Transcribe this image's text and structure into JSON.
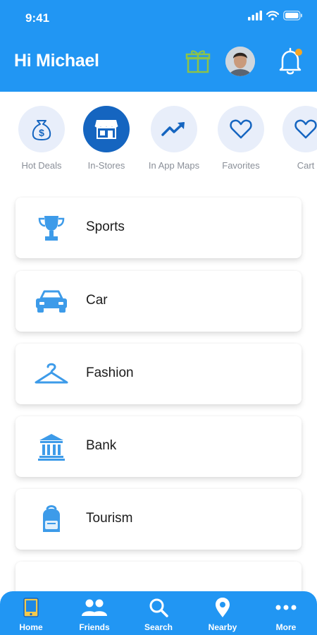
{
  "status": {
    "time": "9:41"
  },
  "header": {
    "greeting": "Hi Michael",
    "bell_badge_color": "#f5a623"
  },
  "colors": {
    "primary": "#2196f3",
    "active": "#1565c0",
    "icon": "#3d9be9",
    "gift": "#8bc34a"
  },
  "quick_actions": [
    {
      "label": "Hot Deals",
      "icon": "money-bag-icon",
      "active": false
    },
    {
      "label": "In-Stores",
      "icon": "store-icon",
      "active": true
    },
    {
      "label": "In App Maps",
      "icon": "trending-up-icon",
      "active": false
    },
    {
      "label": "Favorites",
      "icon": "heart-icon",
      "active": false
    },
    {
      "label": "Cart",
      "icon": "heart-icon",
      "active": false
    }
  ],
  "categories": [
    {
      "label": "Sports",
      "icon": "trophy-icon"
    },
    {
      "label": "Car",
      "icon": "car-icon"
    },
    {
      "label": "Fashion",
      "icon": "hanger-icon"
    },
    {
      "label": "Bank",
      "icon": "bank-icon"
    },
    {
      "label": "Tourism",
      "icon": "backpack-icon"
    }
  ],
  "tabs": [
    {
      "label": "Home",
      "icon": "home-icon"
    },
    {
      "label": "Friends",
      "icon": "friends-icon"
    },
    {
      "label": "Search",
      "icon": "search-icon"
    },
    {
      "label": "Nearby",
      "icon": "location-pin-icon"
    },
    {
      "label": "More",
      "icon": "more-dots-icon"
    }
  ]
}
